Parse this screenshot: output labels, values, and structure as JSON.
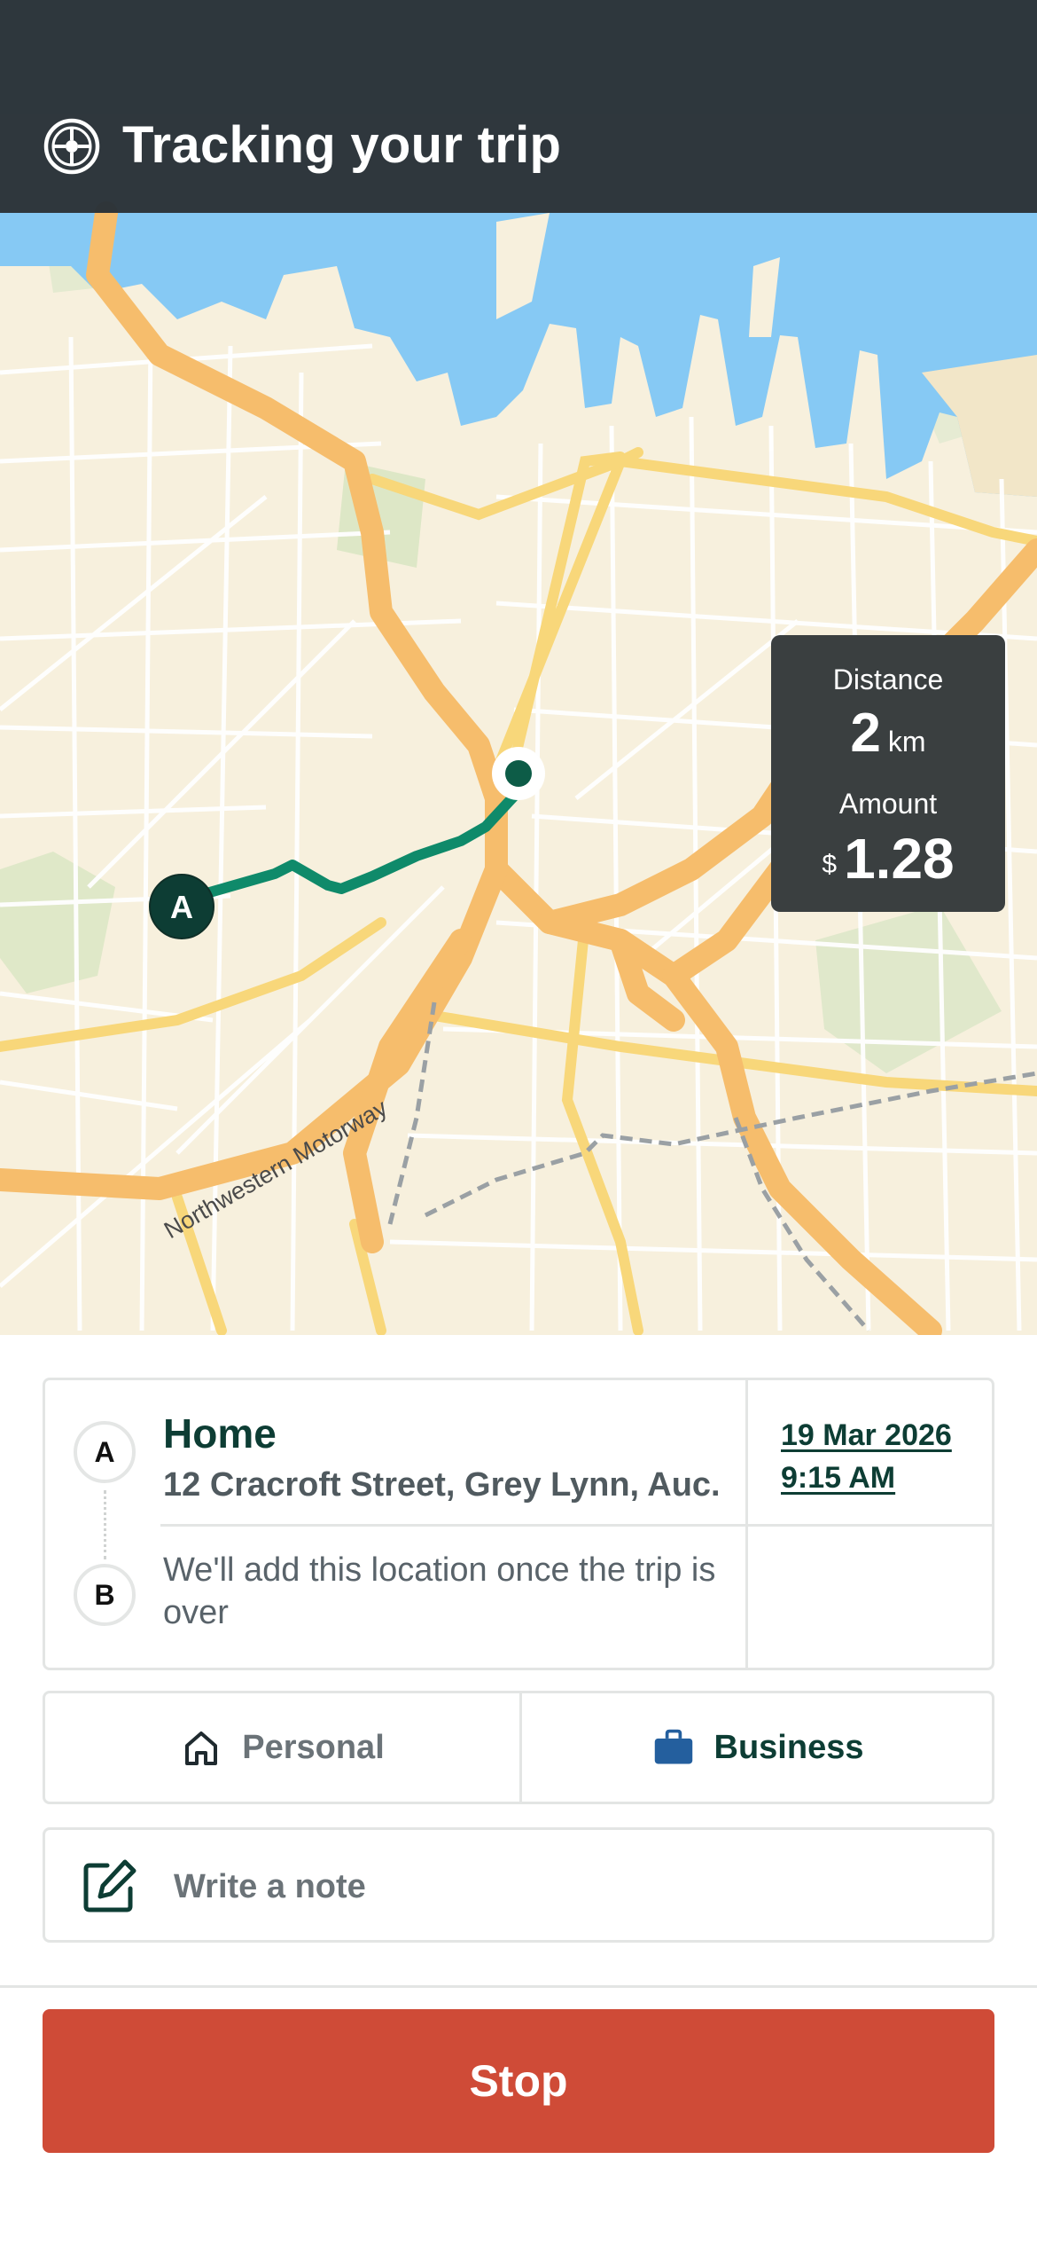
{
  "header": {
    "title": "Tracking your trip",
    "icon": "steering-wheel-icon"
  },
  "map": {
    "road_label": "Northwestern Motorway",
    "start_marker": "A",
    "route_color": "#0f8a6a",
    "water_color": "#86c9f4"
  },
  "stats": {
    "distance_label": "Distance",
    "distance_value": "2",
    "distance_unit": "km",
    "amount_label": "Amount",
    "amount_currency": "$",
    "amount_value": "1.28"
  },
  "trip": {
    "start_badge": "A",
    "start_name": "Home",
    "start_address": "12 Cracroft Street, Grey Lynn, Auc...",
    "date": "19 Mar 2026",
    "time": "9:15 AM",
    "end_badge": "B",
    "end_placeholder": "We'll add this location once the trip is over"
  },
  "trip_type": {
    "personal_label": "Personal",
    "personal_icon": "home-icon",
    "business_label": "Business",
    "business_icon": "briefcase-icon",
    "selected": "Business"
  },
  "note": {
    "placeholder": "Write a note",
    "icon": "edit-note-icon"
  },
  "actions": {
    "stop_label": "Stop",
    "stop_color": "#cf4b37"
  }
}
